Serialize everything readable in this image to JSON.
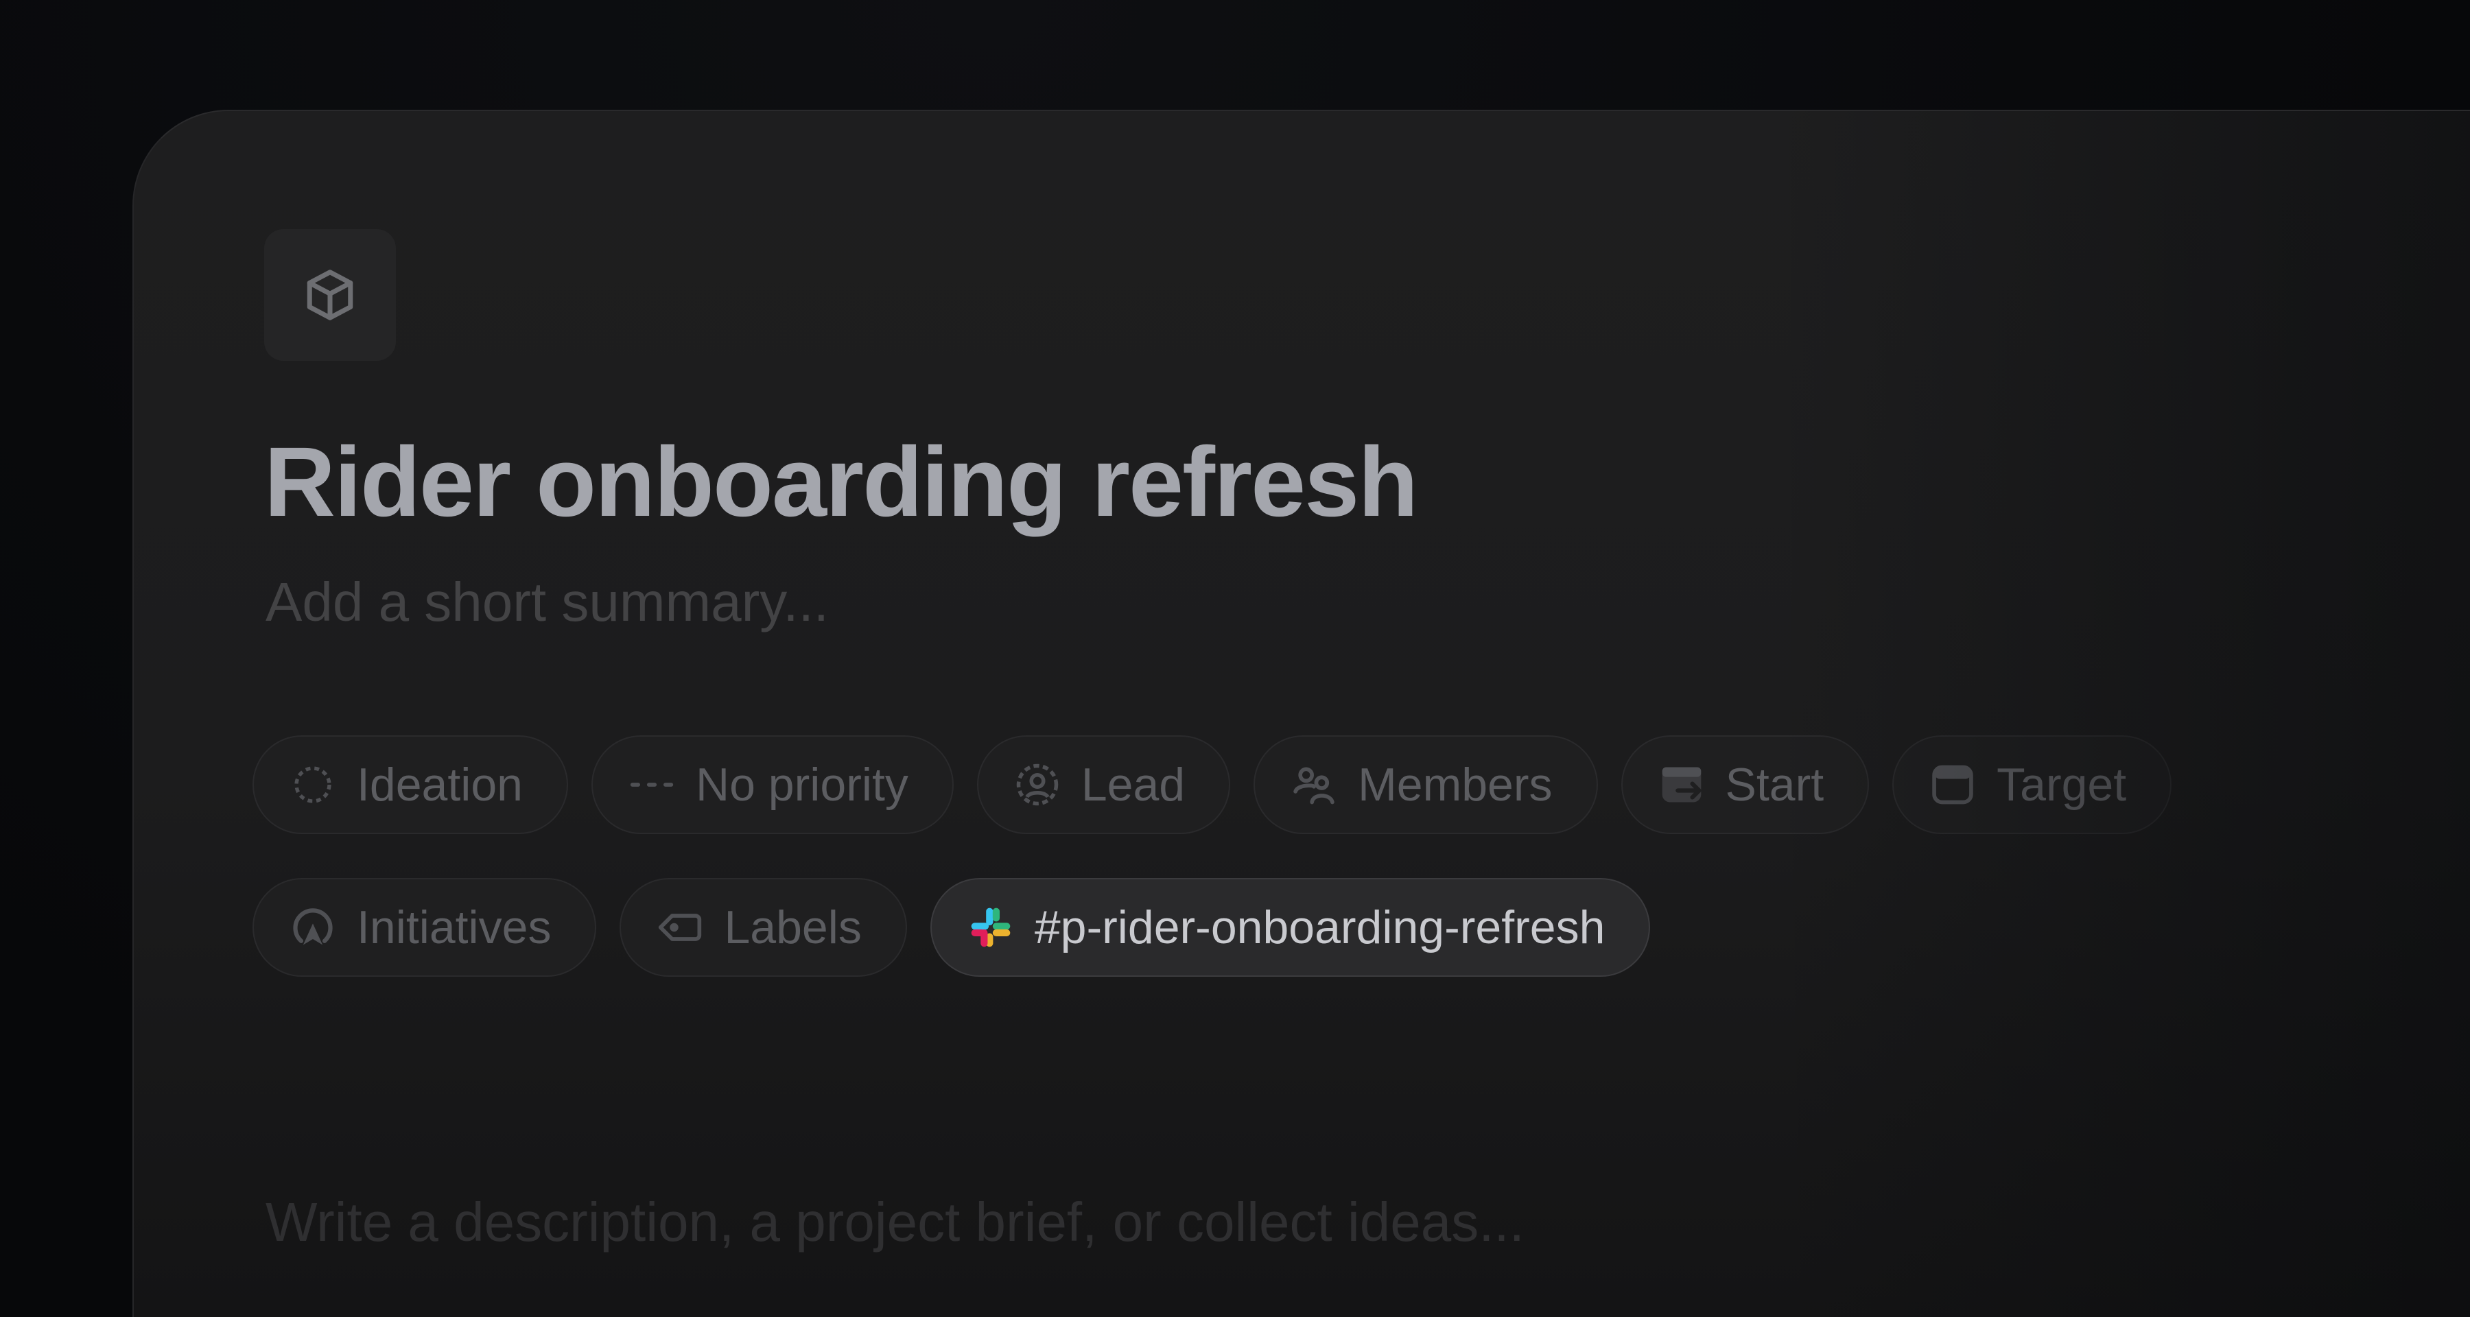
{
  "project": {
    "icon": "box-icon",
    "title": "Rider onboarding refresh",
    "summary_placeholder": "Add a short summary...",
    "description_placeholder": "Write a description, a project brief, or collect ideas..."
  },
  "properties": {
    "status": {
      "label": "Ideation",
      "icon": "dashed-circle-icon"
    },
    "priority": {
      "label": "No priority",
      "icon": "dashes-icon"
    },
    "lead": {
      "label": "Lead",
      "icon": "user-circle-icon"
    },
    "members": {
      "label": "Members",
      "icon": "users-icon"
    },
    "start": {
      "label": "Start",
      "icon": "calendar-start-icon"
    },
    "target": {
      "label": "Target",
      "icon": "calendar-target-icon"
    },
    "initiatives": {
      "label": "Initiatives",
      "icon": "initiative-icon"
    },
    "labels": {
      "label": "Labels",
      "icon": "tag-icon"
    },
    "slack_channel": {
      "label": "#p-rider-onboarding-refresh",
      "icon": "slack-icon"
    }
  },
  "colors": {
    "slack_blue": "#36C5F0",
    "slack_green": "#2EB67D",
    "slack_yellow": "#ECB22E",
    "slack_red": "#E01E5A"
  }
}
